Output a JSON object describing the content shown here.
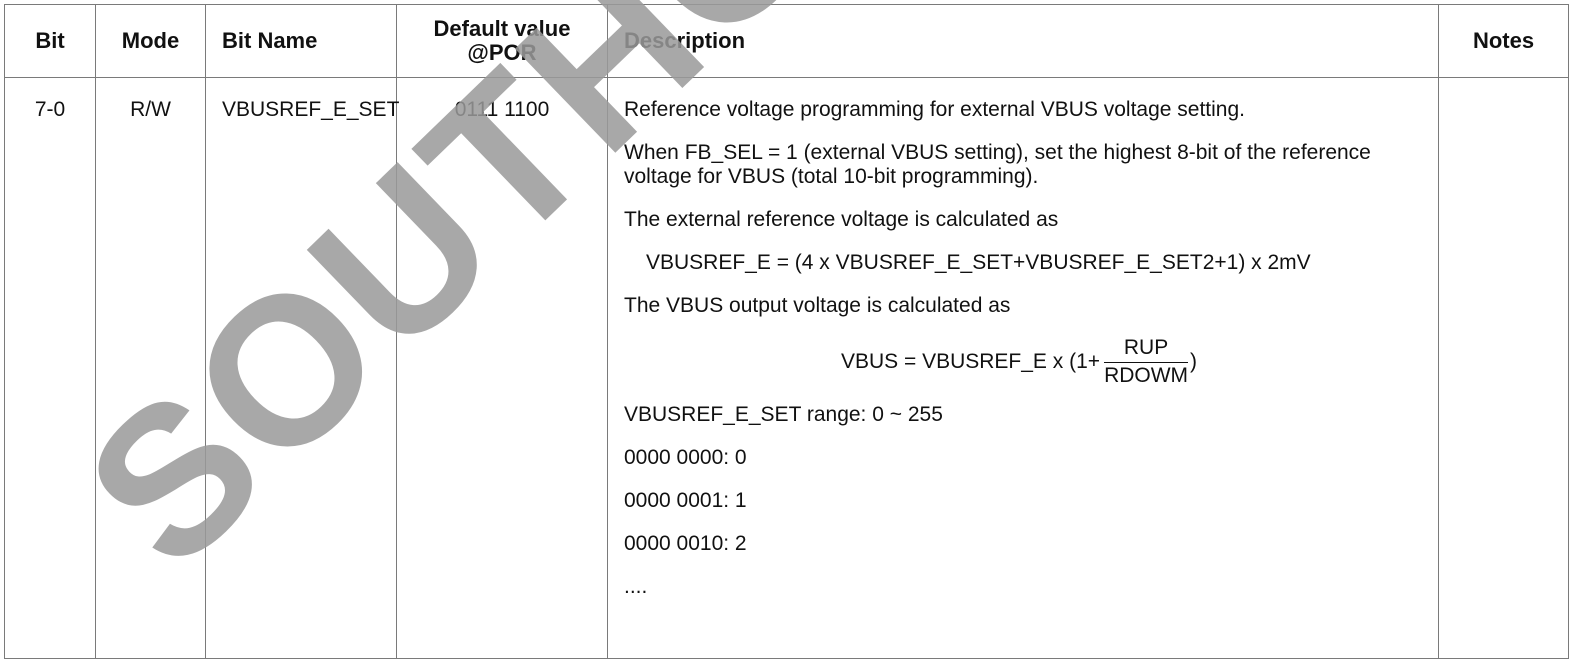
{
  "table": {
    "headers": {
      "bit": "Bit",
      "mode": "Mode",
      "bit_name": "Bit Name",
      "default": "Default value @POR",
      "description": "Description",
      "notes": "Notes"
    },
    "row": {
      "bit": "7-0",
      "mode": "R/W",
      "bit_name": "VBUSREF_E_SET",
      "default": "0111 1100",
      "desc": {
        "p1": "Reference voltage programming for external VBUS voltage setting.",
        "p2": "When FB_SEL = 1 (external VBUS setting), set the highest 8-bit of the reference voltage for VBUS (total 10-bit programming).",
        "p3": "The external reference voltage is calculated as",
        "eq1": "VBUSREF_E = (4 x VBUSREF_E_SET+VBUSREF_E_SET2+1) x 2mV",
        "p4": "The VBUS output voltage is calculated as",
        "eq2_left": "VBUS = VBUSREF_E x (1+",
        "eq2_num": "RUP",
        "eq2_den": "RDOWM",
        "eq2_right": ")",
        "range": "VBUSREF_E_SET range: 0 ~ 255",
        "v0": "0000 0000: 0",
        "v1": "0000 0001: 1",
        "v2": "0000 0010: 2",
        "ellipsis": "...."
      },
      "notes": ""
    }
  },
  "watermark": "SOUTHCHIP"
}
